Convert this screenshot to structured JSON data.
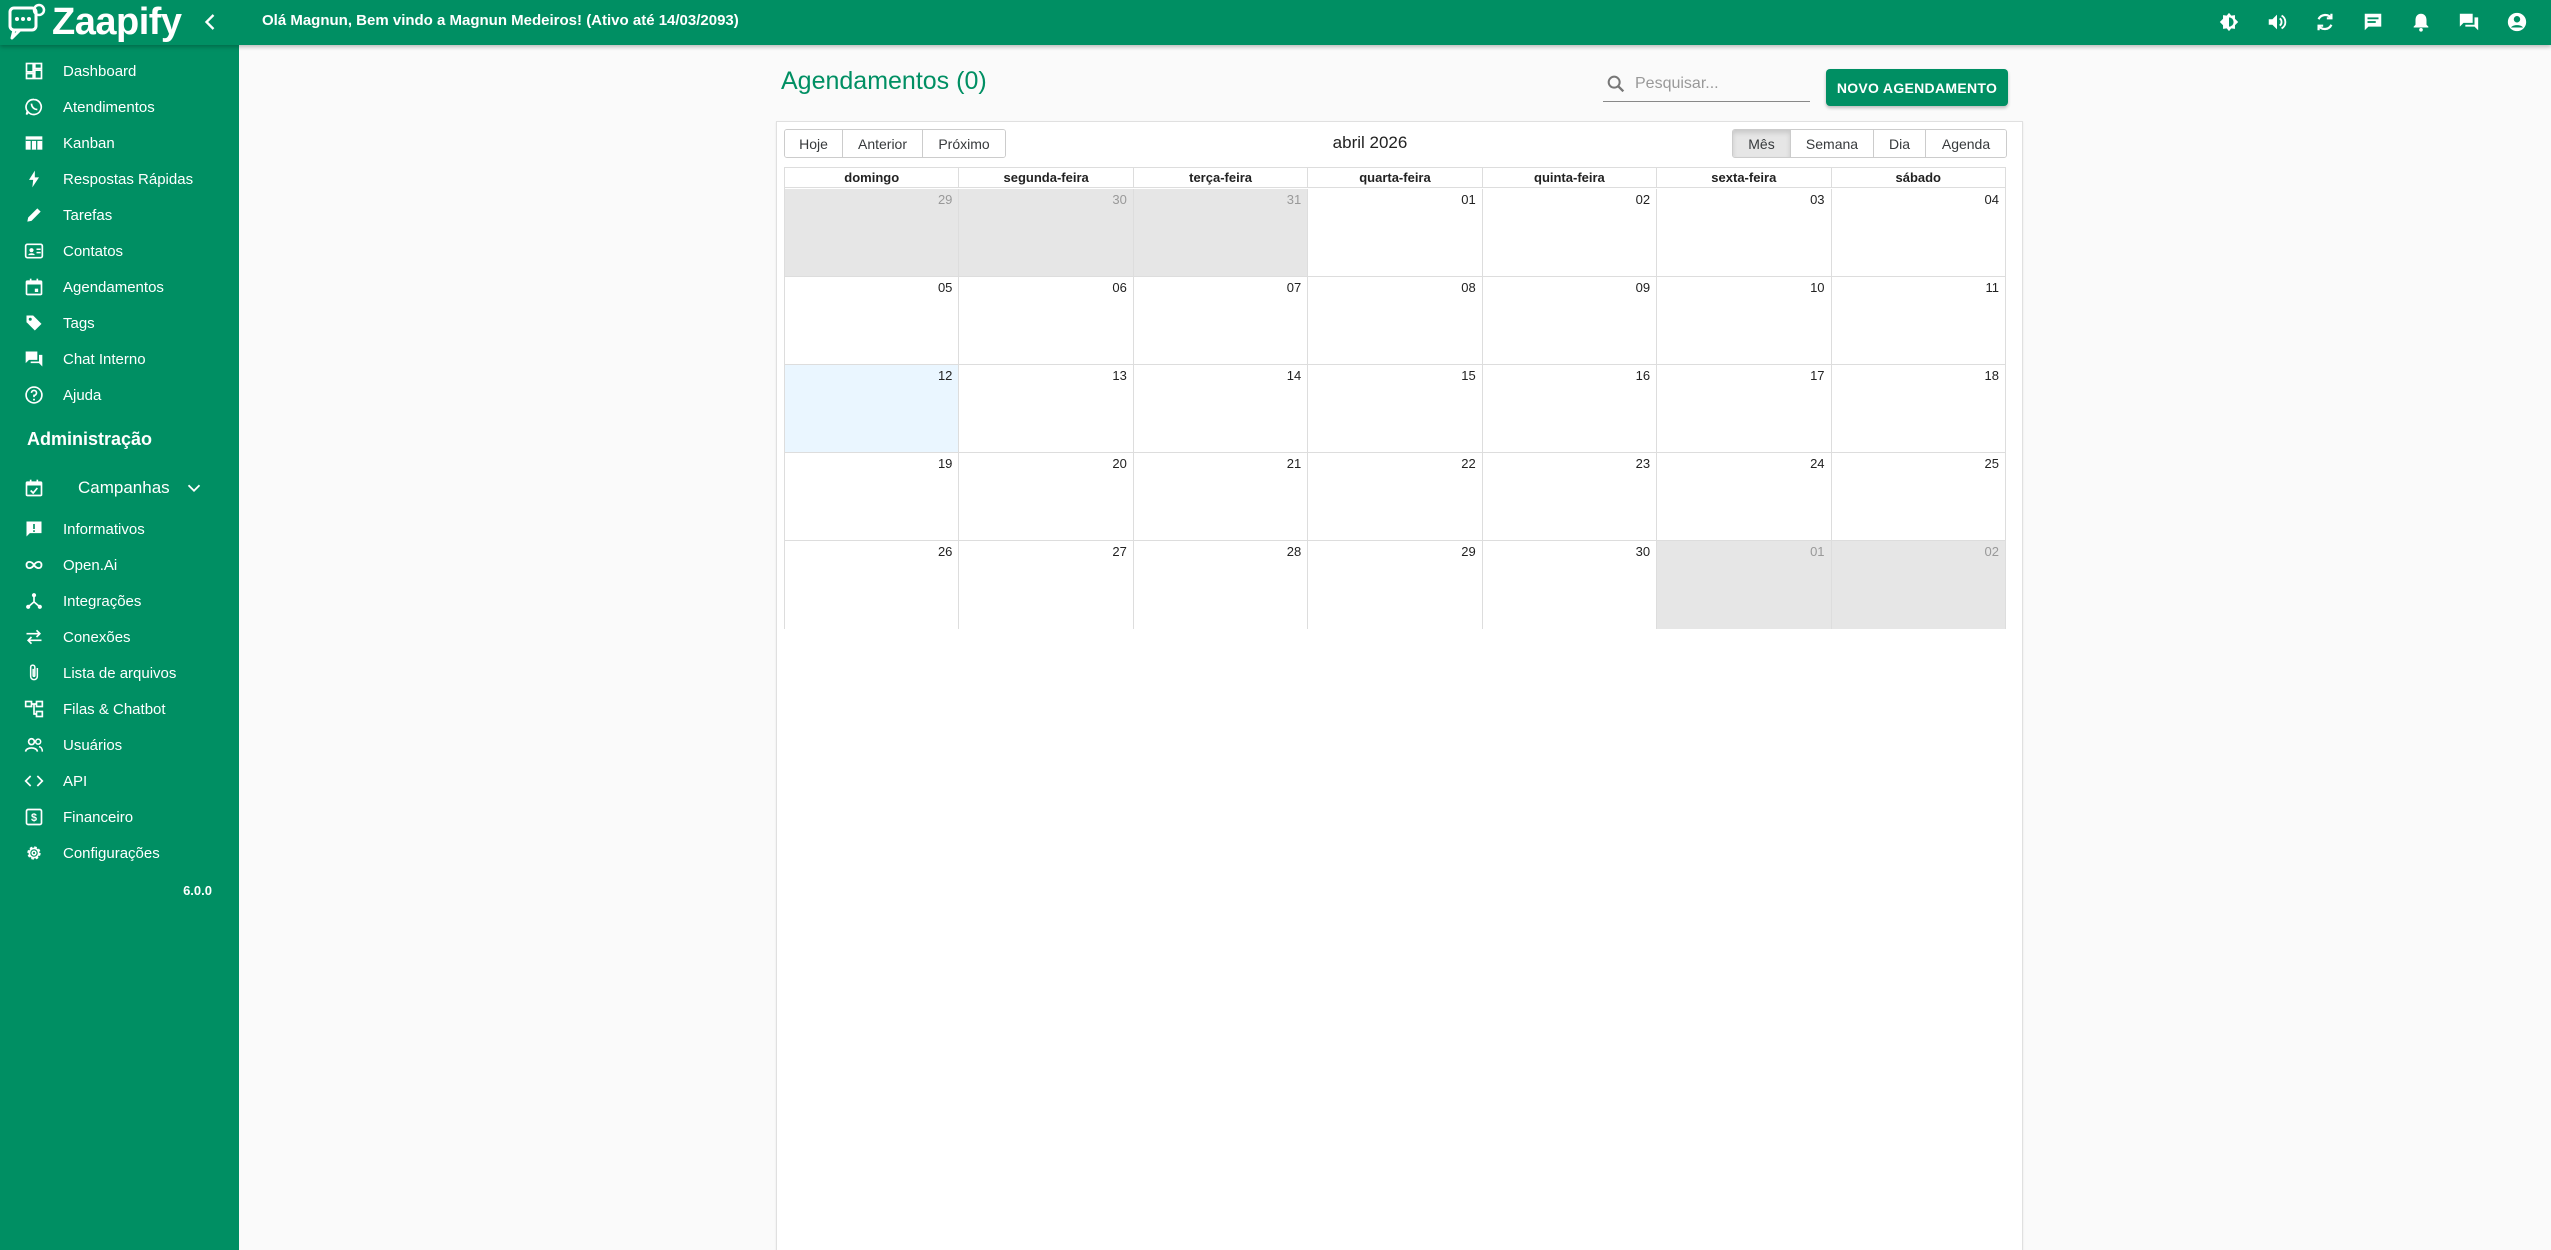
{
  "app": {
    "name": "Zaapify",
    "greeting": "Olá Magnun, Bem vindo a Magnun Medeiros! (Ativo até 14/03/2093)",
    "brand_color": "#008f63",
    "top_icons": [
      "brightness-icon",
      "volume-icon",
      "refresh-icon",
      "chat-bubble-icon",
      "bell-icon",
      "forum-icon",
      "account-icon"
    ]
  },
  "sidebar": {
    "items": [
      {
        "label": "Dashboard",
        "icon": "dashboard-icon"
      },
      {
        "label": "Atendimentos",
        "icon": "whatsapp-icon"
      },
      {
        "label": "Kanban",
        "icon": "kanban-icon"
      },
      {
        "label": "Respostas Rápidas",
        "icon": "bolt-icon"
      },
      {
        "label": "Tarefas",
        "icon": "pencil-icon"
      },
      {
        "label": "Contatos",
        "icon": "contact-card-icon"
      },
      {
        "label": "Agendamentos",
        "icon": "calendar-icon"
      },
      {
        "label": "Tags",
        "icon": "tag-icon"
      },
      {
        "label": "Chat Interno",
        "icon": "chat-icon"
      },
      {
        "label": "Ajuda",
        "icon": "help-icon"
      }
    ],
    "admin_heading": "Administração",
    "campanhas": {
      "label": "Campanhas",
      "icon": "event-check-icon"
    },
    "admin_items": [
      {
        "label": "Informativos",
        "icon": "announcement-icon"
      },
      {
        "label": "Open.Ai",
        "icon": "infinity-icon"
      },
      {
        "label": "Integrações",
        "icon": "hub-icon"
      },
      {
        "label": "Conexões",
        "icon": "swap-icon"
      },
      {
        "label": "Lista de arquivos",
        "icon": "paperclip-icon"
      },
      {
        "label": "Filas & Chatbot",
        "icon": "tree-icon"
      },
      {
        "label": "Usuários",
        "icon": "users-icon"
      },
      {
        "label": "API",
        "icon": "code-icon"
      },
      {
        "label": "Financeiro",
        "icon": "money-icon"
      },
      {
        "label": "Configurações",
        "icon": "gear-icon"
      }
    ],
    "version": "6.0.0"
  },
  "main": {
    "title": "Agendamentos (0)",
    "search_placeholder": "Pesquisar...",
    "new_button": "NOVO AGENDAMENTO"
  },
  "calendar": {
    "nav_buttons": [
      "Hoje",
      "Anterior",
      "Próximo"
    ],
    "label": "abril 2026",
    "views": [
      "Mês",
      "Semana",
      "Dia",
      "Agenda"
    ],
    "active_view": "Mês",
    "weekdays": [
      "domingo",
      "segunda-feira",
      "terça-feira",
      "quarta-feira",
      "quinta-feira",
      "sexta-feira",
      "sábado"
    ],
    "today": "12",
    "weeks": [
      [
        {
          "d": "29",
          "off": true
        },
        {
          "d": "30",
          "off": true
        },
        {
          "d": "31",
          "off": true
        },
        {
          "d": "01"
        },
        {
          "d": "02"
        },
        {
          "d": "03"
        },
        {
          "d": "04"
        }
      ],
      [
        {
          "d": "05"
        },
        {
          "d": "06"
        },
        {
          "d": "07"
        },
        {
          "d": "08"
        },
        {
          "d": "09"
        },
        {
          "d": "10"
        },
        {
          "d": "11"
        }
      ],
      [
        {
          "d": "12",
          "today": true
        },
        {
          "d": "13"
        },
        {
          "d": "14"
        },
        {
          "d": "15"
        },
        {
          "d": "16"
        },
        {
          "d": "17"
        },
        {
          "d": "18"
        }
      ],
      [
        {
          "d": "19"
        },
        {
          "d": "20"
        },
        {
          "d": "21"
        },
        {
          "d": "22"
        },
        {
          "d": "23"
        },
        {
          "d": "24"
        },
        {
          "d": "25"
        }
      ],
      [
        {
          "d": "26"
        },
        {
          "d": "27"
        },
        {
          "d": "28"
        },
        {
          "d": "29"
        },
        {
          "d": "30"
        },
        {
          "d": "01",
          "off": true
        },
        {
          "d": "02",
          "off": true
        }
      ]
    ]
  }
}
